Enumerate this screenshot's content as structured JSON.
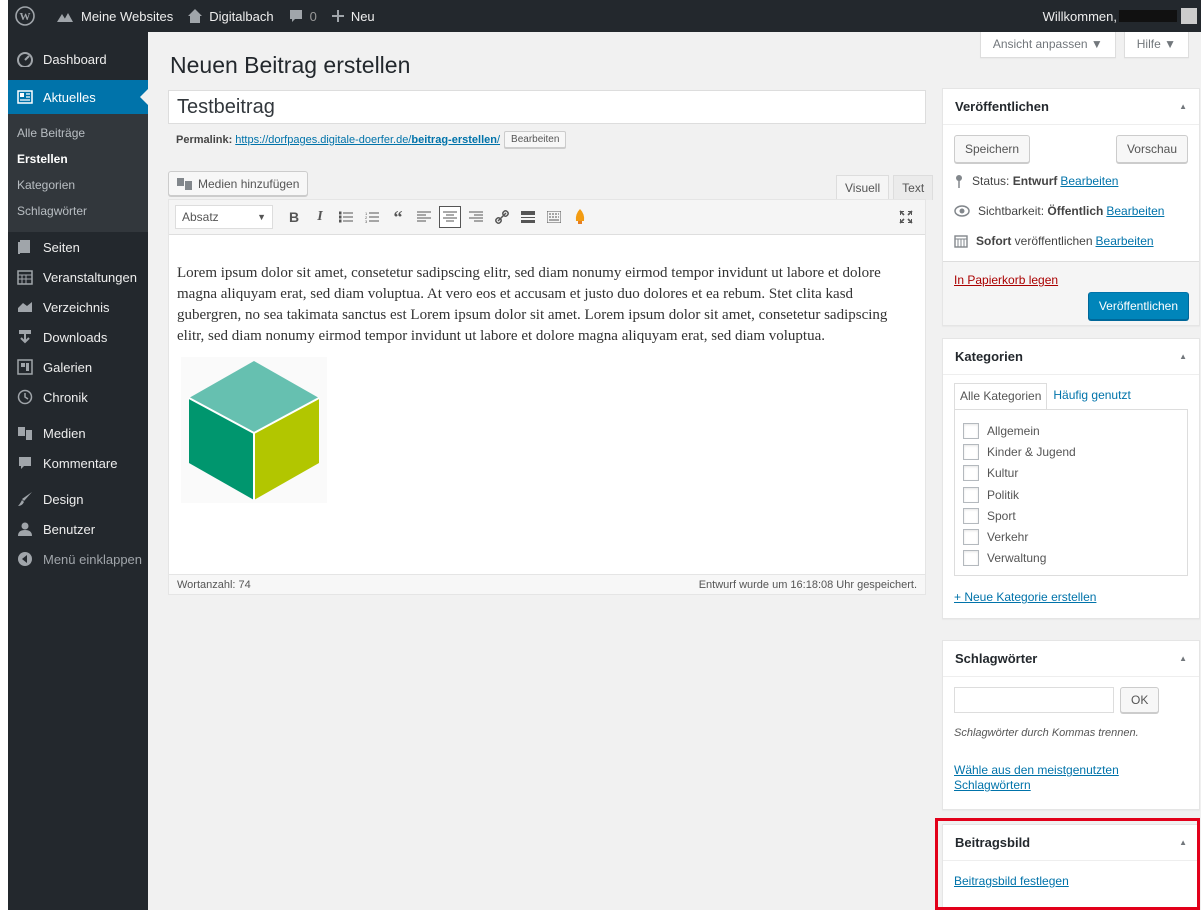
{
  "adminbar": {
    "my_sites": "Meine Websites",
    "site_name": "Digitalbach",
    "comments_count": "0",
    "new_label": "Neu",
    "welcome": "Willkommen,"
  },
  "sidebar": {
    "dashboard": "Dashboard",
    "aktuelles": "Aktuelles",
    "sub": [
      "Alle Beiträge",
      "Erstellen",
      "Kategorien",
      "Schlagwörter"
    ],
    "items": [
      "Seiten",
      "Veranstaltungen",
      "Verzeichnis",
      "Downloads",
      "Galerien",
      "Chronik",
      "Medien",
      "Kommentare",
      "Design",
      "Benutzer",
      "Menü einklappen"
    ]
  },
  "screen_options": {
    "ansicht": "Ansicht anpassen",
    "hilfe": "Hilfe"
  },
  "page_title": "Neuen Beitrag erstellen",
  "post": {
    "title": "Testbeitrag",
    "permalink_label": "Permalink:",
    "permalink_base": "https://dorfpages.digitale-doerfer.de/",
    "permalink_slug": "beitrag-erstellen",
    "permalink_trail": "/",
    "permalink_edit": "Bearbeiten",
    "add_media": "Medien hinzufügen",
    "tab_visual": "Visuell",
    "tab_text": "Text",
    "format": "Absatz",
    "body": "Lorem ipsum dolor sit amet, consetetur sadipscing elitr, sed diam nonumy eirmod tempor invidunt ut labore et dolore magna aliquyam erat, sed diam voluptua. At vero eos et accusam et justo duo dolores et ea rebum. Stet clita kasd gubergren, no sea takimata sanctus est Lorem ipsum dolor sit amet. Lorem ipsum dolor sit amet, consetetur sadipscing elitr, sed diam nonumy eirmod tempor invidunt ut labore et dolore magna aliquyam erat, sed diam voluptua.",
    "wordcount": "Wortanzahl: 74",
    "autosave": "Entwurf wurde um 16:18:08 Uhr gespeichert."
  },
  "publish": {
    "title": "Veröffentlichen",
    "save": "Speichern",
    "preview": "Vorschau",
    "status_label": "Status:",
    "status_value": "Entwurf",
    "visibility_label": "Sichtbarkeit:",
    "visibility_value": "Öffentlich",
    "schedule_value": "Sofort",
    "schedule_label": "veröffentlichen",
    "edit": "Bearbeiten",
    "trash": "In Papierkorb legen",
    "publish_button": "Veröffentlichen"
  },
  "categories": {
    "title": "Kategorien",
    "tab_all": "Alle Kategorien",
    "tab_popular": "Häufig genutzt",
    "items": [
      "Allgemein",
      "Kinder & Jugend",
      "Kultur",
      "Politik",
      "Sport",
      "Verkehr",
      "Verwaltung"
    ],
    "add_new": "+ Neue Kategorie erstellen"
  },
  "tags": {
    "title": "Schlagwörter",
    "ok": "OK",
    "hint": "Schlagwörter durch Kommas trennen.",
    "choose_line1": "Wähle aus den meistgenutzten",
    "choose_line2": "Schlagwörtern"
  },
  "featured": {
    "title": "Beitragsbild",
    "set": "Beitragsbild festlegen"
  },
  "colors": {
    "accent": "#0073aa",
    "sidebar": "#23282d",
    "highlight": "#e2001a"
  }
}
